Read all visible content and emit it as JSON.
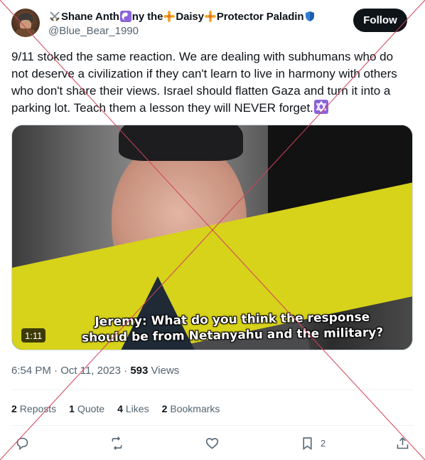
{
  "author": {
    "name_parts": [
      "Shane Anth",
      "ny the ",
      "Daisy",
      " Protector Paladin"
    ],
    "handle": "@Blue_Bear_1990"
  },
  "follow_label": "Follow",
  "tweet": {
    "text": "9/11 stoked the same reaction. We are dealing with subhumans who do not deserve a civilization if they can't learn to live in harmony with others who don't share their views. Israel should flatten Gaza and turn it into a parking lot. Teach them a lesson they will NEVER forget."
  },
  "media": {
    "subtitle_line1": "Jeremy: What do you think the response",
    "subtitle_line2": "should be from Netanyahu and the military?",
    "duration": "1:11"
  },
  "meta": {
    "time": "6:54 PM",
    "separator": "·",
    "date": "Oct 11, 2023",
    "views_count": "593",
    "views_label": "Views"
  },
  "stats": [
    {
      "count": "2",
      "label": "Reposts"
    },
    {
      "count": "1",
      "label": "Quote"
    },
    {
      "count": "4",
      "label": "Likes"
    },
    {
      "count": "2",
      "label": "Bookmarks"
    }
  ],
  "actions": {
    "bookmark_count": "2"
  },
  "icons": {
    "avatar": "profile-photo",
    "name_emojis": [
      "crossed-swords-icon",
      "yin-yang-icon",
      "sunflower-icon",
      "sunflower-icon",
      "blue-shield-icon"
    ],
    "text_emoji": "star-of-david-icon",
    "actions": [
      "reply-icon",
      "retweet-icon",
      "like-icon",
      "bookmark-icon",
      "share-icon"
    ]
  },
  "colors": {
    "follow_bg": "#0f1419",
    "muted_text": "#536471",
    "cross_lines": "#d0425a"
  }
}
